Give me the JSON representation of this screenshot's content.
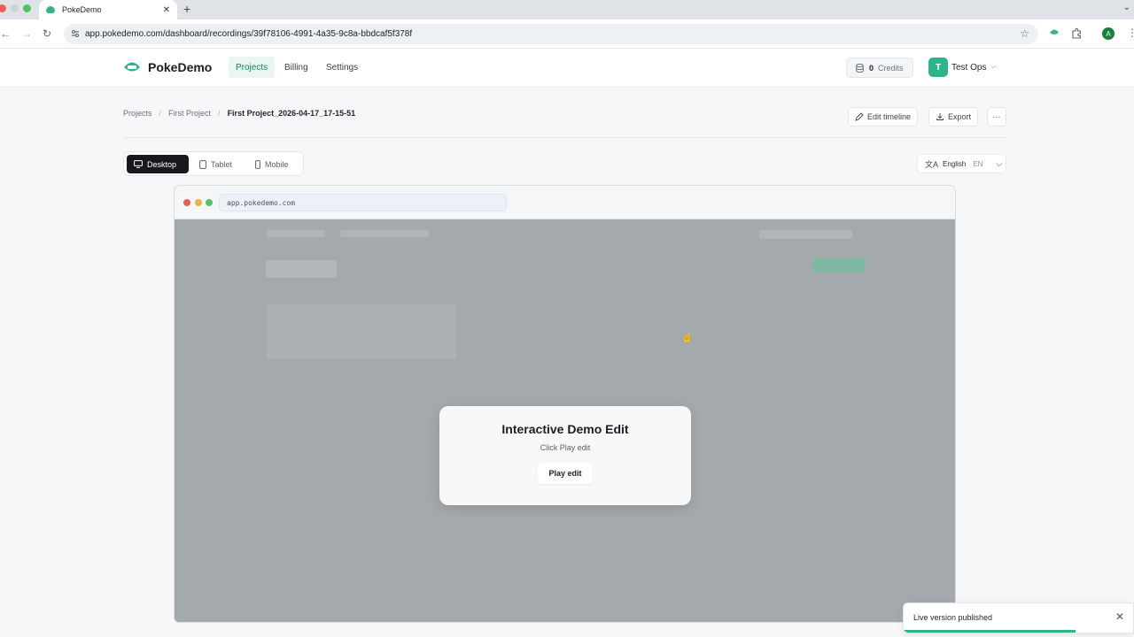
{
  "browser": {
    "tab_title": "PokeDemo",
    "url": "app.pokedemo.com/dashboard/recordings/39f78106-4991-4a35-9c8a-bbdcaf5f378f",
    "profile_initial": "A"
  },
  "header": {
    "brand": "PokeDemo",
    "nav": [
      "Projects",
      "Billing",
      "Settings"
    ],
    "credits_count": "0",
    "credits_label": "Credits",
    "user_initial": "T",
    "user_name": "Test Ops"
  },
  "breadcrumb": [
    "Projects",
    "First Project",
    "First Project_2026-04-17_17-15-51"
  ],
  "toolbar": {
    "edit_timeline": "Edit timeline",
    "export": "Export",
    "more": "···"
  },
  "devices": [
    "Desktop",
    "Tablet",
    "Mobile"
  ],
  "language": {
    "name": "English",
    "code": "EN"
  },
  "preview": {
    "url": "app.pokedemo.com",
    "dialog_title": "Interactive Demo Edit",
    "dialog_subtitle": "Click Play edit",
    "dialog_button": "Play edit"
  },
  "toast": {
    "message": "Live version published",
    "progress": 0.75
  },
  "colors": {
    "accent": "#2fb38a",
    "dark": "#16181c"
  }
}
